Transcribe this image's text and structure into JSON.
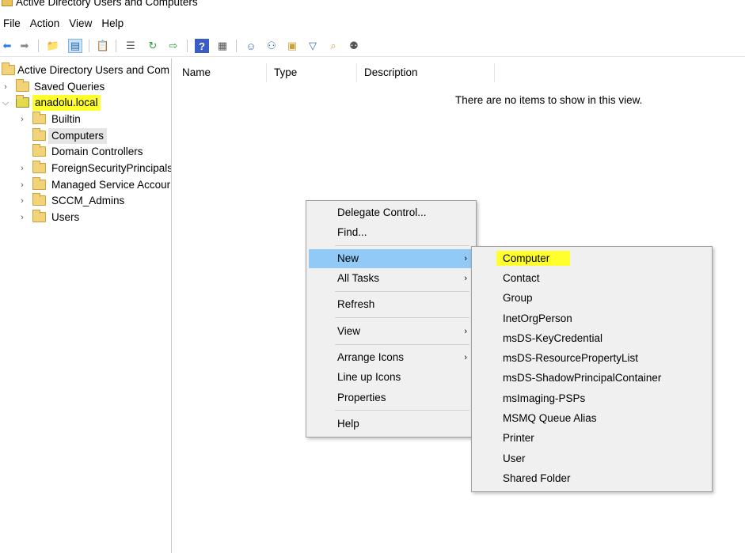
{
  "window": {
    "title": "Active Directory Users and Computers"
  },
  "menubar": [
    "File",
    "Action",
    "View",
    "Help"
  ],
  "toolbar": {
    "icons": [
      "back-icon",
      "forward-icon",
      "up-folder-icon",
      "show-hide-tree-icon",
      "copy-icon",
      "export-list-icon",
      "refresh-icon",
      "export-icon",
      "help-icon",
      "console-tree-icon",
      "new-user-icon",
      "new-group-icon",
      "new-ou-icon",
      "filter-icon",
      "find-icon",
      "add-to-group-icon"
    ]
  },
  "tree": {
    "root": "Active Directory Users and Com",
    "saved_queries": "Saved Queries",
    "domain": "anadolu.local",
    "children": [
      {
        "label": "Builtin",
        "expandable": true
      },
      {
        "label": "Computers",
        "expandable": false,
        "selected": true
      },
      {
        "label": "Domain Controllers",
        "expandable": false
      },
      {
        "label": "ForeignSecurityPrincipals",
        "expandable": true
      },
      {
        "label": "Managed Service Accour",
        "expandable": true
      },
      {
        "label": "SCCM_Admins",
        "expandable": true
      },
      {
        "label": "Users",
        "expandable": true
      }
    ]
  },
  "list": {
    "columns": [
      "Name",
      "Type",
      "Description"
    ],
    "empty_message": "There are no items to show in this view."
  },
  "context_menu": {
    "items": [
      {
        "label": "Delegate Control...",
        "submenu": false
      },
      {
        "label": "Find...",
        "submenu": false
      },
      {
        "label": "New",
        "submenu": true,
        "active": true
      },
      {
        "label": "All Tasks",
        "submenu": true
      },
      {
        "label": "Refresh",
        "submenu": false
      },
      {
        "label": "View",
        "submenu": true
      },
      {
        "label": "Arrange Icons",
        "submenu": true
      },
      {
        "label": "Line up Icons",
        "submenu": false
      },
      {
        "label": "Properties",
        "submenu": false
      },
      {
        "label": "Help",
        "submenu": false
      }
    ]
  },
  "new_submenu": {
    "items": [
      "Computer",
      "Contact",
      "Group",
      "InetOrgPerson",
      "msDS-KeyCredential",
      "msDS-ResourcePropertyList",
      "msDS-ShadowPrincipalContainer",
      "msImaging-PSPs",
      "MSMQ Queue Alias",
      "Printer",
      "User",
      "Shared Folder"
    ]
  },
  "colors": {
    "highlight": "#ffff2e",
    "menu_active": "#91c9f7",
    "menu_bg": "#f0f0f0"
  }
}
